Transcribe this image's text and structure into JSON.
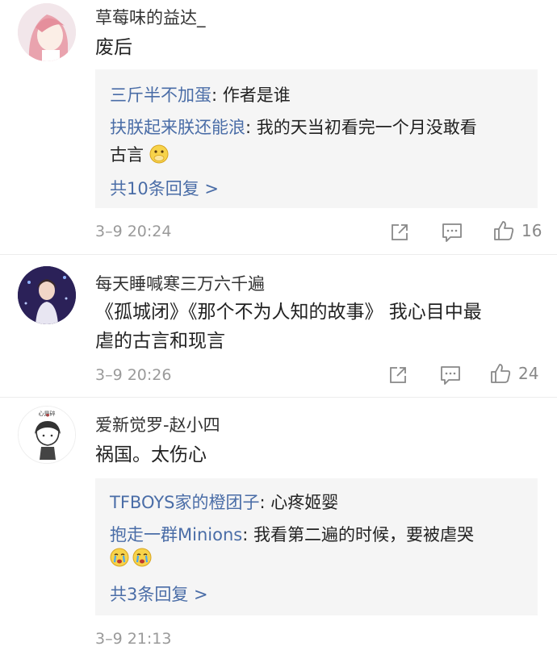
{
  "comments": [
    {
      "username": "草莓味的益达_",
      "text": "废后",
      "replies": [
        {
          "user": "三斤半不加蛋",
          "text": ": 作者是谁"
        },
        {
          "user": "扶朕起来朕还能浪",
          "text": ": 我的天当初看完一个月没敢看",
          "text2": "古言"
        }
      ],
      "more_label": "共10条回复 >",
      "time": "3–9 20:24",
      "like_count": "16"
    },
    {
      "username": "每天睡喊寒三万六千遍",
      "text_line1": "《孤城闭》《那个不为人知的故事》 我心目中最",
      "text_line2": "虐的古言和现言",
      "time": "3–9 20:26",
      "like_count": "24"
    },
    {
      "username": "爱新觉罗-赵小四",
      "text": "祸国。太伤心",
      "avatar_text": "心是碎",
      "replies": [
        {
          "user": "TFBOYS家的橙团子",
          "text": ": 心疼姬婴"
        },
        {
          "user": "抱走一群Minions",
          "text": ": 我看第二遍的时候，要被虐哭"
        }
      ],
      "more_label": "共3条回复 >",
      "time": "3–9 21:13"
    }
  ],
  "colors": {
    "link_blue": "#4a6da7",
    "reply_bg": "#f5f5f5",
    "meta_gray": "#9a9a9a"
  }
}
